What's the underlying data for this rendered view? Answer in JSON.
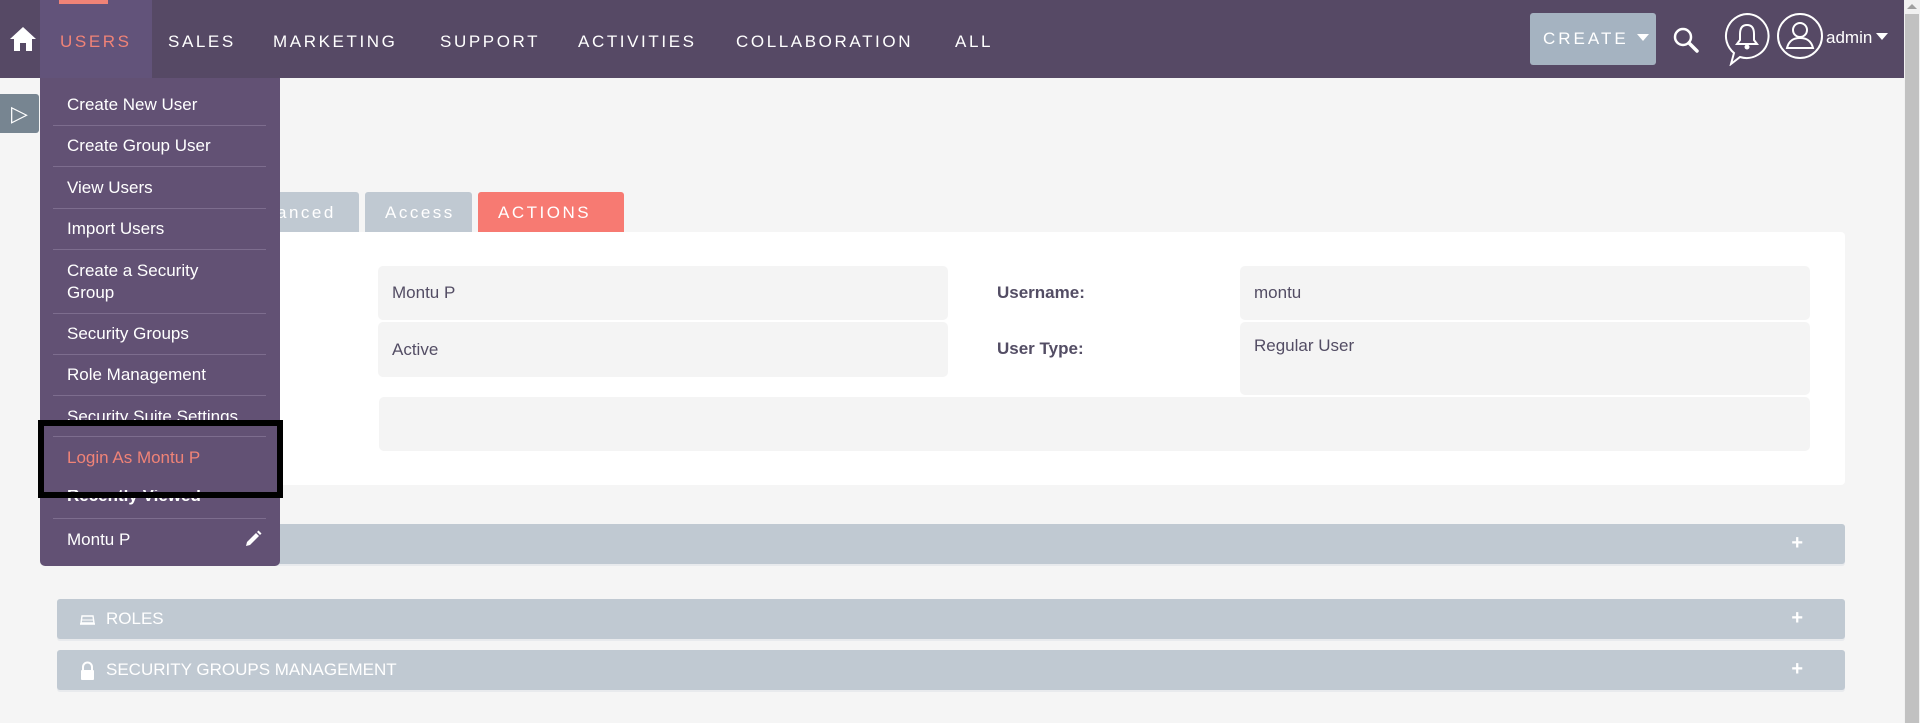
{
  "nav": {
    "home_icon": "home-icon",
    "items": [
      {
        "label": "USERS",
        "active": true
      },
      {
        "label": "SALES"
      },
      {
        "label": "MARKETING"
      },
      {
        "label": "SUPPORT"
      },
      {
        "label": "ACTIVITIES"
      },
      {
        "label": "COLLABORATION"
      },
      {
        "label": "ALL"
      }
    ],
    "create_label": "CREATE",
    "user_label": "admin"
  },
  "users_menu": {
    "items": [
      {
        "label": "Create New User"
      },
      {
        "label": "Create Group User"
      },
      {
        "label": "View Users"
      },
      {
        "label": "Import Users"
      },
      {
        "label": "Create a Security Group"
      },
      {
        "label": "Security Groups"
      },
      {
        "label": "Role Management"
      },
      {
        "label": "Security Suite Settings"
      },
      {
        "label": "Login As Montu P",
        "highlighted": true
      }
    ],
    "recently_viewed_heading": "Recently Viewed",
    "recent_items": [
      {
        "label": "Montu P",
        "action_icon": "pencil-icon"
      }
    ]
  },
  "tabs": [
    {
      "label": "Advanced",
      "visible_text": "anced"
    },
    {
      "label": "Access"
    },
    {
      "label": "ACTIONS"
    }
  ],
  "detail": {
    "full_name": "Montu P",
    "status": "Active",
    "username_label": "Username:",
    "username": "montu",
    "user_type_label": "User Type:",
    "user_type": "Regular User",
    "extra_value": ""
  },
  "panels": [
    {
      "title": "",
      "icon": "none"
    },
    {
      "title": "ROLES",
      "icon": "roles-icon"
    },
    {
      "title": "SECURITY GROUPS MANAGEMENT",
      "icon": "lock-icon"
    }
  ],
  "colors": {
    "header_bg": "#564965",
    "menu_bg": "#625174",
    "accent": "#f08377",
    "actions_tab": "#f77a72",
    "tab_bg": "#c0c9d2",
    "create_btn": "#a5b3c1"
  }
}
